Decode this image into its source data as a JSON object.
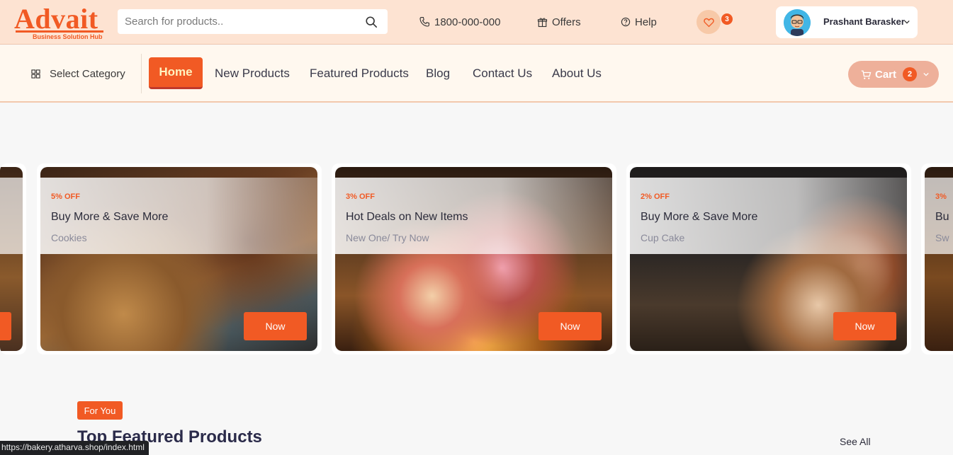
{
  "brand": {
    "name": "Advait",
    "tagline": "Business Solution Hub",
    "accent": "#f15a24"
  },
  "header": {
    "search_placeholder": "Search for products..",
    "phone": "1800-000-000",
    "offers_label": "Offers",
    "help_label": "Help",
    "wishlist_count": "3",
    "user_name": "Prashant Barasker"
  },
  "nav": {
    "category_label": "Select Category",
    "links": [
      "Home",
      "New Products",
      "Featured Products",
      "Blog",
      "Contact Us",
      "About Us"
    ],
    "active": "Home",
    "cart_label": "Cart",
    "cart_count": "2"
  },
  "carousel": {
    "left_partial": {
      "button": ""
    },
    "cards": [
      {
        "discount": "5% OFF",
        "title": "Buy More & Save More",
        "subtitle": "Cookies",
        "button": "Now",
        "image": "cookies-display"
      },
      {
        "discount": "3% OFF",
        "title": "Hot Deals on New Items",
        "subtitle": "New One/ Try Now",
        "button": "Now",
        "image": "cakes-on-rack"
      },
      {
        "discount": "2% OFF",
        "title": "Buy More & Save More",
        "subtitle": "Cup Cake",
        "button": "Now",
        "image": "strawberry-cakes"
      }
    ],
    "right_partial": {
      "discount": "3%",
      "title": "Bu",
      "subtitle": "Sw"
    }
  },
  "section": {
    "badge": "For You",
    "title": "Top Featured Products",
    "see_all": "See All"
  },
  "status_bar": {
    "url": "https://bakery.atharva.shop/index.html"
  }
}
